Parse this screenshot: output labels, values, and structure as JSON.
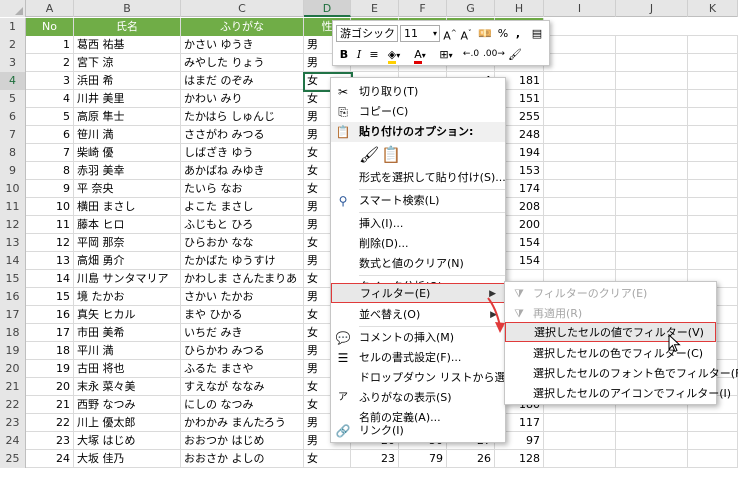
{
  "columns": [
    "A",
    "B",
    "C",
    "D",
    "E",
    "F",
    "G",
    "H",
    "I",
    "J",
    "K"
  ],
  "selected_column": "D",
  "selected_row": "4",
  "header_row": {
    "row": "1",
    "a": "No",
    "b": "氏名",
    "c": "ふりがな",
    "d": "性"
  },
  "rows": [
    {
      "n": "2",
      "a": "1",
      "b": "葛西 祐基",
      "c": "かさい ゆうき",
      "d": "男",
      "e": "",
      "f": "",
      "g": "",
      "h": "181"
    },
    {
      "n": "3",
      "a": "2",
      "b": "宮下 涼",
      "c": "みやした りょう",
      "d": "男",
      "e": "",
      "f": "",
      "g": "",
      "h": "220"
    },
    {
      "n": "4",
      "a": "3",
      "b": "浜田 希",
      "c": "はまだ のぞみ",
      "d": "女",
      "e": "",
      "f": "",
      "g": "4",
      "h": "181"
    },
    {
      "n": "5",
      "a": "4",
      "b": "川井 美里",
      "c": "かわい みり",
      "d": "女",
      "e": "",
      "f": "",
      "g": "1",
      "h": "151"
    },
    {
      "n": "6",
      "a": "5",
      "b": "高原 隼士",
      "c": "たかはら しゅんじ",
      "d": "男",
      "e": "",
      "f": "",
      "g": "8",
      "h": "255"
    },
    {
      "n": "7",
      "a": "6",
      "b": "笹川 満",
      "c": "ささがわ みつる",
      "d": "男",
      "e": "",
      "f": "",
      "g": "2",
      "h": "248"
    },
    {
      "n": "8",
      "a": "7",
      "b": "柴崎 優",
      "c": "しばざき ゆう",
      "d": "女",
      "e": "",
      "f": "",
      "g": "2",
      "h": "194"
    },
    {
      "n": "9",
      "a": "8",
      "b": "赤羽 美幸",
      "c": "あかばね みゆき",
      "d": "女",
      "e": "",
      "f": "",
      "g": "1",
      "h": "153"
    },
    {
      "n": "10",
      "a": "9",
      "b": "平 奈央",
      "c": "たいら なお",
      "d": "女",
      "e": "",
      "f": "",
      "g": "0",
      "h": "174"
    },
    {
      "n": "11",
      "a": "10",
      "b": "横田 まさし",
      "c": "よこた まさし",
      "d": "男",
      "e": "",
      "f": "",
      "g": "6",
      "h": "208"
    },
    {
      "n": "12",
      "a": "11",
      "b": "藤本 ヒロ",
      "c": "ふじもと ひろ",
      "d": "男",
      "e": "",
      "f": "",
      "g": "5",
      "h": "200"
    },
    {
      "n": "13",
      "a": "12",
      "b": "平岡 那奈",
      "c": "ひらおか なな",
      "d": "女",
      "e": "",
      "f": "",
      "g": "1",
      "h": "154"
    },
    {
      "n": "14",
      "a": "13",
      "b": "高畑 勇介",
      "c": "たかばた ゆうすけ",
      "d": "男",
      "e": "",
      "f": "",
      "g": "3",
      "h": "154"
    },
    {
      "n": "15",
      "a": "14",
      "b": "川島 サンタマリア",
      "c": "かわしま さんたまりあ",
      "d": "女",
      "e": "",
      "f": "",
      "g": "",
      "h": ""
    },
    {
      "n": "16",
      "a": "15",
      "b": "境 たかお",
      "c": "さかい たかお",
      "d": "男",
      "e": "",
      "f": "",
      "g": "",
      "h": ""
    },
    {
      "n": "17",
      "a": "16",
      "b": "真矢 ヒカル",
      "c": "まや ひかる",
      "d": "女",
      "e": "",
      "f": "",
      "g": "",
      "h": ""
    },
    {
      "n": "18",
      "a": "17",
      "b": "市田 美希",
      "c": "いちだ みき",
      "d": "女",
      "e": "",
      "f": "",
      "g": "",
      "h": ""
    },
    {
      "n": "19",
      "a": "18",
      "b": "平川 満",
      "c": "ひらかわ みつる",
      "d": "男",
      "e": "",
      "f": "",
      "g": "",
      "h": ""
    },
    {
      "n": "20",
      "a": "19",
      "b": "古田 将也",
      "c": "ふるた まさや",
      "d": "男",
      "e": "",
      "f": "",
      "g": "",
      "h": ""
    },
    {
      "n": "21",
      "a": "20",
      "b": "末永 菜々美",
      "c": "すえなが ななみ",
      "d": "女",
      "e": "",
      "f": "",
      "g": "",
      "h": ""
    },
    {
      "n": "22",
      "a": "21",
      "b": "西野 なつみ",
      "c": "にしの なつみ",
      "d": "女",
      "e": "",
      "f": "",
      "g": "5",
      "h": "180"
    },
    {
      "n": "23",
      "a": "22",
      "b": "川上 優太郎",
      "c": "かわかみ まんたろう",
      "d": "男",
      "e": "",
      "f": "",
      "g": "1",
      "h": "117"
    },
    {
      "n": "24",
      "a": "23",
      "b": "大塚 はじめ",
      "c": "おおつか はじめ",
      "d": "男",
      "e": "20",
      "f": "50",
      "g": "27",
      "h": "97"
    },
    {
      "n": "25",
      "a": "24",
      "b": "大坂 佳乃",
      "c": "おおさか よしの",
      "d": "女",
      "e": "23",
      "f": "79",
      "g": "26",
      "h": "128"
    }
  ],
  "mini_toolbar": {
    "font_name": "游ゴシック",
    "font_size": "11",
    "bold": "B",
    "italic": "I",
    "percent": "%",
    "comma": ","
  },
  "context_menu": {
    "items": [
      {
        "label": "切り取り(T)",
        "icon": "scissors-icon",
        "glyph": "✂"
      },
      {
        "label": "コピー(C)",
        "icon": "copy-icon",
        "glyph": "⎘"
      },
      {
        "label": "貼り付けのオプション:",
        "icon": "paste-icon",
        "glyph": "📋"
      },
      {
        "label": "形式を選択して貼り付け(S)...",
        "icon": "",
        "glyph": ""
      },
      {
        "label": "スマート検索(L)",
        "icon": "smart-lookup-icon",
        "glyph": "⚲"
      },
      {
        "label": "挿入(I)...",
        "icon": "",
        "glyph": ""
      },
      {
        "label": "削除(D)...",
        "icon": "",
        "glyph": ""
      },
      {
        "label": "数式と値のクリア(N)",
        "icon": "",
        "glyph": ""
      },
      {
        "label": "クイック分析(Q)",
        "icon": "quick-analysis-icon",
        "glyph": "▦"
      },
      {
        "label": "フィルター(E)",
        "icon": "",
        "glyph": ""
      },
      {
        "label": "並べ替え(O)",
        "icon": "",
        "glyph": ""
      },
      {
        "label": "コメントの挿入(M)",
        "icon": "comment-icon",
        "glyph": "💬"
      },
      {
        "label": "セルの書式設定(F)...",
        "icon": "format-cells-icon",
        "glyph": "☰"
      },
      {
        "label": "ドロップダウン リストから選択(K)...",
        "icon": "",
        "glyph": ""
      },
      {
        "label": "ふりがなの表示(S)",
        "icon": "furigana-icon",
        "glyph": "ア"
      },
      {
        "label": "名前の定義(A)...",
        "icon": "",
        "glyph": ""
      },
      {
        "label": "リンク(I)",
        "icon": "link-icon",
        "glyph": "🔗"
      }
    ]
  },
  "filter_submenu": {
    "items": [
      {
        "label": "フィルターのクリア(E)",
        "disabled": true
      },
      {
        "label": "再適用(R)",
        "disabled": true
      },
      {
        "label": "選択したセルの値でフィルター(V)",
        "disabled": false
      },
      {
        "label": "選択したセルの色でフィルター(C)",
        "disabled": false
      },
      {
        "label": "選択したセルのフォント色でフィルター(F)",
        "disabled": false
      },
      {
        "label": "選択したセルのアイコンでフィルター(I)",
        "disabled": false
      }
    ]
  },
  "colors": {
    "header_green": "#70ad47",
    "selection_green": "#217346",
    "highlight_border": "#e03a3a"
  }
}
